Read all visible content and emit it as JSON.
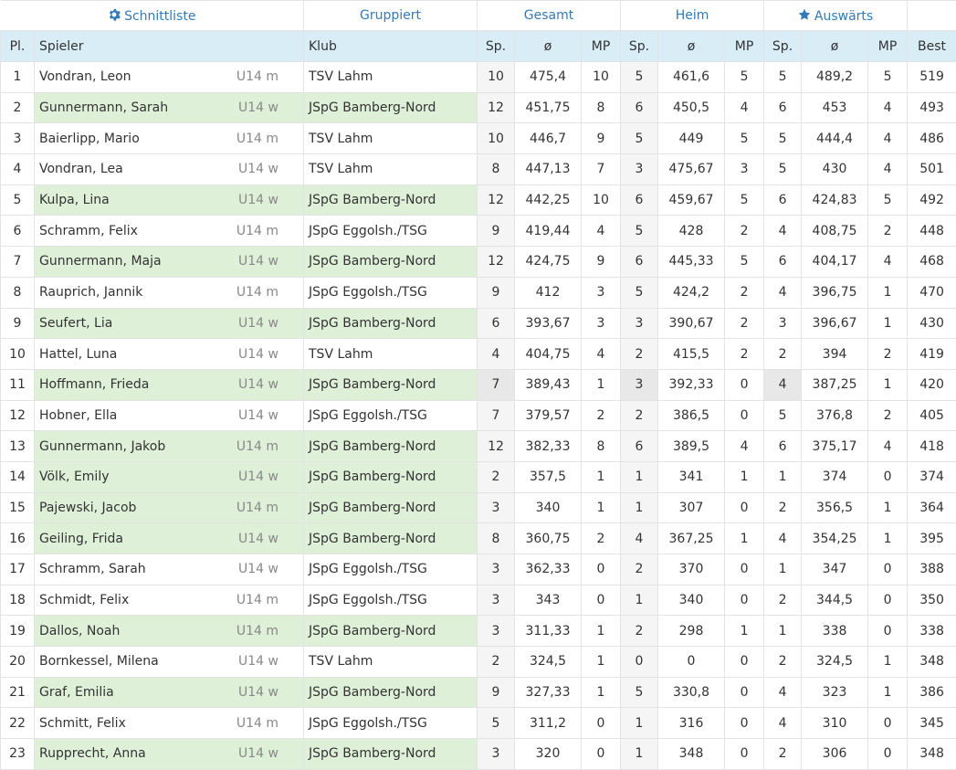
{
  "nav": {
    "schnittliste": "Schnittliste",
    "gruppiert": "Gruppiert",
    "gesamt": "Gesamt",
    "heim": "Heim",
    "auswaerts": "Auswärts"
  },
  "columns": {
    "pl": "Pl.",
    "spieler": "Spieler",
    "klub": "Klub",
    "sp": "Sp.",
    "avg": "ø",
    "mp": "MP",
    "best": "Best"
  },
  "rows": [
    {
      "pl": "1",
      "name": "Vondran, Leon",
      "age": "U14 m",
      "klub": "TSV Lahm",
      "g_sp": "10",
      "g_avg": "475,4",
      "g_mp": "10",
      "h_sp": "5",
      "h_avg": "461,6",
      "h_mp": "5",
      "a_sp": "5",
      "a_avg": "489,2",
      "a_mp": "5",
      "best": "519"
    },
    {
      "pl": "2",
      "name": "Gunnermann, Sarah",
      "age": "U14 w",
      "klub": "JSpG Bamberg-Nord",
      "g_sp": "12",
      "g_avg": "451,75",
      "g_mp": "8",
      "h_sp": "6",
      "h_avg": "450,5",
      "h_mp": "4",
      "a_sp": "6",
      "a_avg": "453",
      "a_mp": "4",
      "best": "493"
    },
    {
      "pl": "3",
      "name": "Baierlipp, Mario",
      "age": "U14 m",
      "klub": "TSV Lahm",
      "g_sp": "10",
      "g_avg": "446,7",
      "g_mp": "9",
      "h_sp": "5",
      "h_avg": "449",
      "h_mp": "5",
      "a_sp": "5",
      "a_avg": "444,4",
      "a_mp": "4",
      "best": "486"
    },
    {
      "pl": "4",
      "name": "Vondran, Lea",
      "age": "U14 w",
      "klub": "TSV Lahm",
      "g_sp": "8",
      "g_avg": "447,13",
      "g_mp": "7",
      "h_sp": "3",
      "h_avg": "475,67",
      "h_mp": "3",
      "a_sp": "5",
      "a_avg": "430",
      "a_mp": "4",
      "best": "501"
    },
    {
      "pl": "5",
      "name": "Kulpa, Lina",
      "age": "U14 w",
      "klub": "JSpG Bamberg-Nord",
      "g_sp": "12",
      "g_avg": "442,25",
      "g_mp": "10",
      "h_sp": "6",
      "h_avg": "459,67",
      "h_mp": "5",
      "a_sp": "6",
      "a_avg": "424,83",
      "a_mp": "5",
      "best": "492"
    },
    {
      "pl": "6",
      "name": "Schramm, Felix",
      "age": "U14 m",
      "klub": "JSpG Eggolsh./TSG",
      "g_sp": "9",
      "g_avg": "419,44",
      "g_mp": "4",
      "h_sp": "5",
      "h_avg": "428",
      "h_mp": "2",
      "a_sp": "4",
      "a_avg": "408,75",
      "a_mp": "2",
      "best": "448"
    },
    {
      "pl": "7",
      "name": "Gunnermann, Maja",
      "age": "U14 w",
      "klub": "JSpG Bamberg-Nord",
      "g_sp": "12",
      "g_avg": "424,75",
      "g_mp": "9",
      "h_sp": "6",
      "h_avg": "445,33",
      "h_mp": "5",
      "a_sp": "6",
      "a_avg": "404,17",
      "a_mp": "4",
      "best": "468"
    },
    {
      "pl": "8",
      "name": "Rauprich, Jannik",
      "age": "U14 m",
      "klub": "JSpG Eggolsh./TSG",
      "g_sp": "9",
      "g_avg": "412",
      "g_mp": "3",
      "h_sp": "5",
      "h_avg": "424,2",
      "h_mp": "2",
      "a_sp": "4",
      "a_avg": "396,75",
      "a_mp": "1",
      "best": "470"
    },
    {
      "pl": "9",
      "name": "Seufert, Lia",
      "age": "U14 w",
      "klub": "JSpG Bamberg-Nord",
      "g_sp": "6",
      "g_avg": "393,67",
      "g_mp": "3",
      "h_sp": "3",
      "h_avg": "390,67",
      "h_mp": "2",
      "a_sp": "3",
      "a_avg": "396,67",
      "a_mp": "1",
      "best": "430"
    },
    {
      "pl": "10",
      "name": "Hattel, Luna",
      "age": "U14 w",
      "klub": "TSV Lahm",
      "g_sp": "4",
      "g_avg": "404,75",
      "g_mp": "4",
      "h_sp": "2",
      "h_avg": "415,5",
      "h_mp": "2",
      "a_sp": "2",
      "a_avg": "394",
      "a_mp": "2",
      "best": "419"
    },
    {
      "pl": "11",
      "name": "Hoffmann, Frieda",
      "age": "U14 w",
      "klub": "JSpG Bamberg-Nord",
      "g_sp": "7",
      "g_avg": "389,43",
      "g_mp": "1",
      "h_sp": "3",
      "h_avg": "392,33",
      "h_mp": "0",
      "a_sp": "4",
      "a_avg": "387,25",
      "a_mp": "1",
      "best": "420"
    },
    {
      "pl": "12",
      "name": "Hobner, Ella",
      "age": "U14 w",
      "klub": "JSpG Eggolsh./TSG",
      "g_sp": "7",
      "g_avg": "379,57",
      "g_mp": "2",
      "h_sp": "2",
      "h_avg": "386,5",
      "h_mp": "0",
      "a_sp": "5",
      "a_avg": "376,8",
      "a_mp": "2",
      "best": "405"
    },
    {
      "pl": "13",
      "name": "Gunnermann, Jakob",
      "age": "U14 m",
      "klub": "JSpG Bamberg-Nord",
      "g_sp": "12",
      "g_avg": "382,33",
      "g_mp": "8",
      "h_sp": "6",
      "h_avg": "389,5",
      "h_mp": "4",
      "a_sp": "6",
      "a_avg": "375,17",
      "a_mp": "4",
      "best": "418"
    },
    {
      "pl": "14",
      "name": "Völk, Emily",
      "age": "U14 w",
      "klub": "JSpG Bamberg-Nord",
      "g_sp": "2",
      "g_avg": "357,5",
      "g_mp": "1",
      "h_sp": "1",
      "h_avg": "341",
      "h_mp": "1",
      "a_sp": "1",
      "a_avg": "374",
      "a_mp": "0",
      "best": "374"
    },
    {
      "pl": "15",
      "name": "Pajewski, Jacob",
      "age": "U14 m",
      "klub": "JSpG Bamberg-Nord",
      "g_sp": "3",
      "g_avg": "340",
      "g_mp": "1",
      "h_sp": "1",
      "h_avg": "307",
      "h_mp": "0",
      "a_sp": "2",
      "a_avg": "356,5",
      "a_mp": "1",
      "best": "364"
    },
    {
      "pl": "16",
      "name": "Geiling, Frida",
      "age": "U14 w",
      "klub": "JSpG Bamberg-Nord",
      "g_sp": "8",
      "g_avg": "360,75",
      "g_mp": "2",
      "h_sp": "4",
      "h_avg": "367,25",
      "h_mp": "1",
      "a_sp": "4",
      "a_avg": "354,25",
      "a_mp": "1",
      "best": "395"
    },
    {
      "pl": "17",
      "name": "Schramm, Sarah",
      "age": "U14 w",
      "klub": "JSpG Eggolsh./TSG",
      "g_sp": "3",
      "g_avg": "362,33",
      "g_mp": "0",
      "h_sp": "2",
      "h_avg": "370",
      "h_mp": "0",
      "a_sp": "1",
      "a_avg": "347",
      "a_mp": "0",
      "best": "388"
    },
    {
      "pl": "18",
      "name": "Schmidt, Felix",
      "age": "U14 m",
      "klub": "JSpG Eggolsh./TSG",
      "g_sp": "3",
      "g_avg": "343",
      "g_mp": "0",
      "h_sp": "1",
      "h_avg": "340",
      "h_mp": "0",
      "a_sp": "2",
      "a_avg": "344,5",
      "a_mp": "0",
      "best": "350"
    },
    {
      "pl": "19",
      "name": "Dallos, Noah",
      "age": "U14 m",
      "klub": "JSpG Bamberg-Nord",
      "g_sp": "3",
      "g_avg": "311,33",
      "g_mp": "1",
      "h_sp": "2",
      "h_avg": "298",
      "h_mp": "1",
      "a_sp": "1",
      "a_avg": "338",
      "a_mp": "0",
      "best": "338"
    },
    {
      "pl": "20",
      "name": "Bornkessel, Milena",
      "age": "U14 w",
      "klub": "TSV Lahm",
      "g_sp": "2",
      "g_avg": "324,5",
      "g_mp": "1",
      "h_sp": "0",
      "h_avg": "0",
      "h_mp": "0",
      "a_sp": "2",
      "a_avg": "324,5",
      "a_mp": "1",
      "best": "348"
    },
    {
      "pl": "21",
      "name": "Graf, Emilia",
      "age": "U14 w",
      "klub": "JSpG Bamberg-Nord",
      "g_sp": "9",
      "g_avg": "327,33",
      "g_mp": "1",
      "h_sp": "5",
      "h_avg": "330,8",
      "h_mp": "0",
      "a_sp": "4",
      "a_avg": "323",
      "a_mp": "1",
      "best": "386"
    },
    {
      "pl": "22",
      "name": "Schmitt, Felix",
      "age": "U14 m",
      "klub": "JSpG Eggolsh./TSG",
      "g_sp": "5",
      "g_avg": "311,2",
      "g_mp": "0",
      "h_sp": "1",
      "h_avg": "316",
      "h_mp": "0",
      "a_sp": "4",
      "a_avg": "310",
      "a_mp": "0",
      "best": "345"
    },
    {
      "pl": "23",
      "name": "Rupprecht, Anna",
      "age": "U14 w",
      "klub": "JSpG Bamberg-Nord",
      "g_sp": "3",
      "g_avg": "320",
      "g_mp": "0",
      "h_sp": "1",
      "h_avg": "348",
      "h_mp": "0",
      "a_sp": "2",
      "a_avg": "306",
      "a_mp": "0",
      "best": "348"
    }
  ],
  "icons": {
    "schnittliste": "gear-icon",
    "auswaerts": "star-icon"
  },
  "colors": {
    "link": "#337ab7",
    "header_bg": "#d9edf7",
    "highlight_club": "#dff0d8"
  }
}
